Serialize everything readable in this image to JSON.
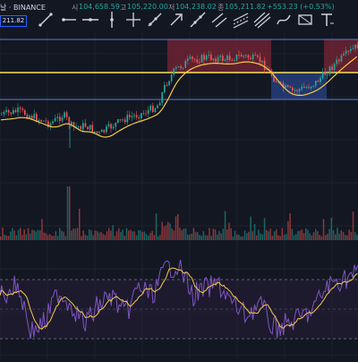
{
  "header": {
    "symbol_fragment": "날 · BINANCE",
    "open_label": "시",
    "open_value": "104,658.59",
    "high_label": "고",
    "high_value": "105,220.00",
    "low_label": "저",
    "low_value": "104,238.02",
    "close_label": "종",
    "close_value": "105,211.82",
    "change": "+553.23 (+0.53%)",
    "price_badge": "211.82"
  },
  "toolbar": {
    "tools": [
      "trendline-tool-icon",
      "horizontal-ray-tool-icon",
      "horizontal-line-tool-icon",
      "vertical-line-tool-icon",
      "cross-line-tool-icon",
      "ray-tool-icon",
      "arrow-tool-icon",
      "extended-line-tool-icon",
      "parallel-channel-tool-icon",
      "regression-channel-tool-icon",
      "pitchfork-tool-icon",
      "brush-tool-icon",
      "rectangle-tool-icon",
      "text-tool-icon"
    ]
  },
  "colors": {
    "background": "#131722",
    "up": "#26a69a",
    "down": "#ef5350",
    "ma": "#f7c948",
    "support_line": "#5b7bd5",
    "red_zone": "#7a2434",
    "blue_zone": "#27407e",
    "rsi_line": "#7e57c2",
    "rsi_ma": "#f7c948"
  }
}
